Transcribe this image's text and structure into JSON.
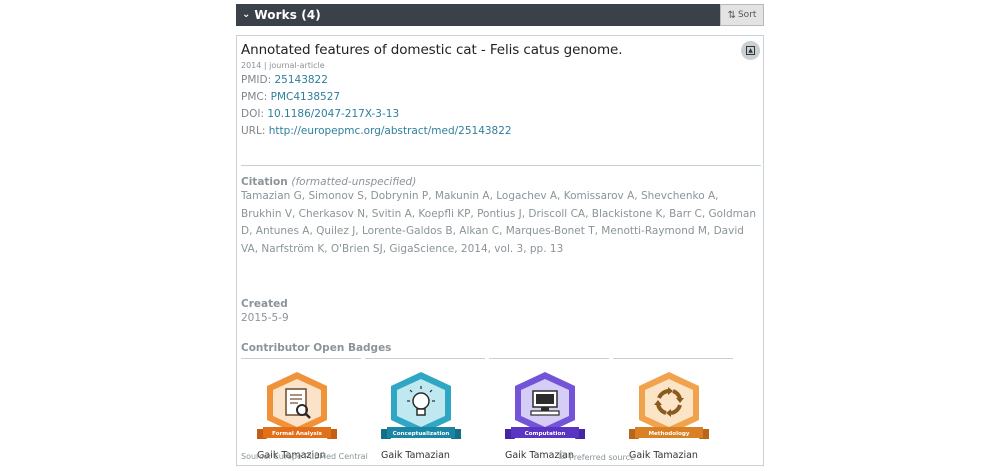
{
  "header": {
    "title": "Works (4)",
    "sort_label": "Sort"
  },
  "work": {
    "title": "Annotated features of domestic cat - Felis catus genome.",
    "meta": "2014 | journal-article",
    "identifiers": [
      {
        "label": "PMID:",
        "value": "25143822"
      },
      {
        "label": "PMC:",
        "value": "PMC4138527"
      },
      {
        "label": "DOI:",
        "value": "10.1186/2047-217X-3-13"
      },
      {
        "label": "URL:",
        "value": "http://europepmc.org/abstract/med/25143822"
      }
    ],
    "citation": {
      "heading": "Citation",
      "qualifier": "(formatted-unspecified)",
      "text": "Tamazian G, Simonov S, Dobrynin P, Makunin A, Logachev A, Komissarov A, Shevchenko A, Brukhin V, Cherkasov N, Svitin A, Koepfli KP, Pontius J, Driscoll CA, Blackistone K, Barr C, Goldman D, Antunes A, Quilez J, Lorente-Galdos B, Alkan C, Marques-Bonet T, Menotti-Raymond M, David VA, Narfström K, O'Brien SJ, GigaScience, 2014, vol. 3, pp. 13"
    },
    "created": {
      "heading": "Created",
      "value": "2015-5-9"
    },
    "badges_heading": "Contributor Open Badges",
    "badges": [
      {
        "label": "Formal Analysis",
        "person": "Gaik Tamazian",
        "icon": "document-magnifier-icon",
        "color": "#f0923a",
        "inner": "#fbe3c9",
        "ribbon": "#e2701b"
      },
      {
        "label": "Conceptualization",
        "person": "Gaik Tamazian",
        "icon": "lightbulb-icon",
        "color": "#2fa6c3",
        "inner": "#bfe8f1",
        "ribbon": "#1b86a4"
      },
      {
        "label": "Computation",
        "person": "Gaik Tamazian",
        "icon": "computer-icon",
        "color": "#7353d8",
        "inner": "#d6cdf6",
        "ribbon": "#5935c2"
      },
      {
        "label": "Methodology",
        "person": "Gaik Tamazian",
        "icon": "cycle-arrows-icon",
        "color": "#f0a24d",
        "inner": "#fce4c6",
        "ribbon": "#d98024"
      }
    ],
    "source": "Source: Europe PubMed Central",
    "preferred": "Preferred source"
  }
}
